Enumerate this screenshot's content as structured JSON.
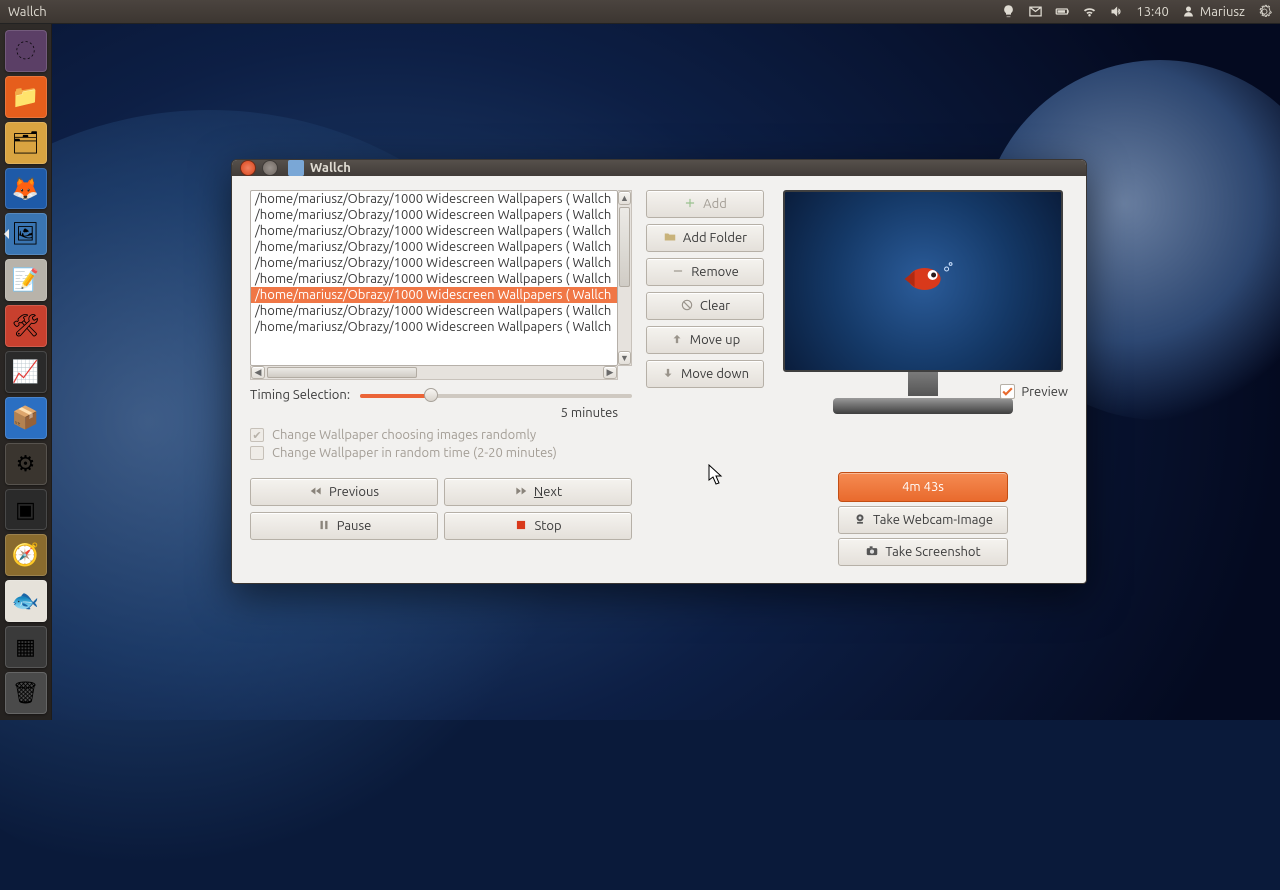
{
  "top_panel": {
    "app_title": "Wallch",
    "time": "13:40",
    "user": "Mariusz"
  },
  "launcher": {
    "tiles": [
      {
        "name": "dash",
        "bg": "#5b3f66",
        "glyph": "◌"
      },
      {
        "name": "files",
        "bg": "#e65e1c",
        "glyph": "📁"
      },
      {
        "name": "home",
        "bg": "#d9a441",
        "glyph": "🗂"
      },
      {
        "name": "firefox",
        "bg": "#1e5aa8",
        "glyph": "🦊"
      },
      {
        "name": "wallch",
        "bg": "#3a75b2",
        "glyph": "🖼",
        "active": true
      },
      {
        "name": "gedit",
        "bg": "#b8b3aa",
        "glyph": "📝"
      },
      {
        "name": "software",
        "bg": "#c8402e",
        "glyph": "🛠"
      },
      {
        "name": "monitor",
        "bg": "#2a2a2a",
        "glyph": "📈"
      },
      {
        "name": "dropbox",
        "bg": "#2b6fc2",
        "glyph": "📦"
      },
      {
        "name": "settings",
        "bg": "#3a352f",
        "glyph": "⚙"
      },
      {
        "name": "terminal",
        "bg": "#2a2a2a",
        "glyph": "▣"
      },
      {
        "name": "compass",
        "bg": "#8a6b2e",
        "glyph": "🧭"
      },
      {
        "name": "goldfish",
        "bg": "#e6e2da",
        "glyph": "🐟"
      },
      {
        "name": "workspace",
        "bg": "#3a3a3a",
        "glyph": "▦"
      }
    ],
    "trash": {
      "name": "trash",
      "bg": "#4a4a4a",
      "glyph": "🗑"
    }
  },
  "window": {
    "title": "Wallch",
    "list": {
      "rows": [
        "/home/mariusz/Obrazy/1000 Widescreen Wallpapers ( Wallch",
        "/home/mariusz/Obrazy/1000 Widescreen Wallpapers ( Wallch",
        "/home/mariusz/Obrazy/1000 Widescreen Wallpapers ( Wallch",
        "/home/mariusz/Obrazy/1000 Widescreen Wallpapers ( Wallch",
        "/home/mariusz/Obrazy/1000 Widescreen Wallpapers ( Wallch",
        "/home/mariusz/Obrazy/1000 Widescreen Wallpapers ( Wallch",
        "/home/mariusz/Obrazy/1000 Widescreen Wallpapers ( Wallch",
        "/home/mariusz/Obrazy/1000 Widescreen Wallpapers ( Wallch",
        "/home/mariusz/Obrazy/1000 Widescreen Wallpapers ( Wallch"
      ],
      "selected_index": 6
    },
    "side_buttons": {
      "add": "Add",
      "add_folder": "Add Folder",
      "remove": "Remove",
      "clear": "Clear",
      "move_up": "Move up",
      "move_down": "Move down"
    },
    "timing": {
      "label": "Timing Selection:",
      "value": "5 minutes"
    },
    "checks": {
      "random_images": "Change Wallpaper choosing images randomly",
      "random_time": "Change Wallpaper in random time (2-20 minutes)"
    },
    "nav": {
      "previous": "Previous",
      "next": "Next",
      "pause": "Pause",
      "stop": "Stop"
    },
    "right": {
      "preview_label": "Preview",
      "timer": "4m 43s",
      "webcam": "Take Webcam-Image",
      "screenshot": "Take Screenshot"
    }
  }
}
